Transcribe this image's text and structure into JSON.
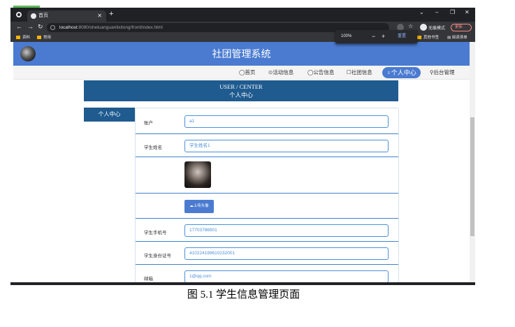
{
  "browser": {
    "tab_title": "首页",
    "new_tab_symbol": "+",
    "url_host": "localhost",
    "url_rest": ":8080/shetuanguanlixitong/front/index.html",
    "incognito_label": "无痕模式",
    "update_label": "更新",
    "bookmarks": [
      "资料",
      "常用"
    ],
    "bookmarks_right": [
      "其他书签",
      "阅读清单"
    ],
    "zoom": {
      "value": "100%",
      "minus": "−",
      "plus": "+",
      "reset": "重置"
    }
  },
  "site": {
    "title": "社团管理系统",
    "nav": [
      {
        "label": "◯首页"
      },
      {
        "label": "⊙活动信息"
      },
      {
        "label": "◯公告信息"
      },
      {
        "label": "☐社团信息"
      },
      {
        "label": "♀个人中心"
      },
      {
        "label": "⚲后台管理"
      }
    ],
    "banner_en": "USER / CENTER",
    "banner_cn": "个人中心",
    "side_menu": "个人中心"
  },
  "form": {
    "account_label": "账户",
    "account_value": "a1",
    "name_label": "学生姓名",
    "name_value": "学生姓名1",
    "upload_label": "☁上传头像",
    "phone_label": "学生手机号",
    "phone_value": "17703786901",
    "idcard_label": "学生身份证号",
    "idcard_value": "410224199610232001",
    "email_label": "邮箱",
    "email_value": "1@qq.com"
  },
  "caption": "图 5.1  学生信息管理页面"
}
